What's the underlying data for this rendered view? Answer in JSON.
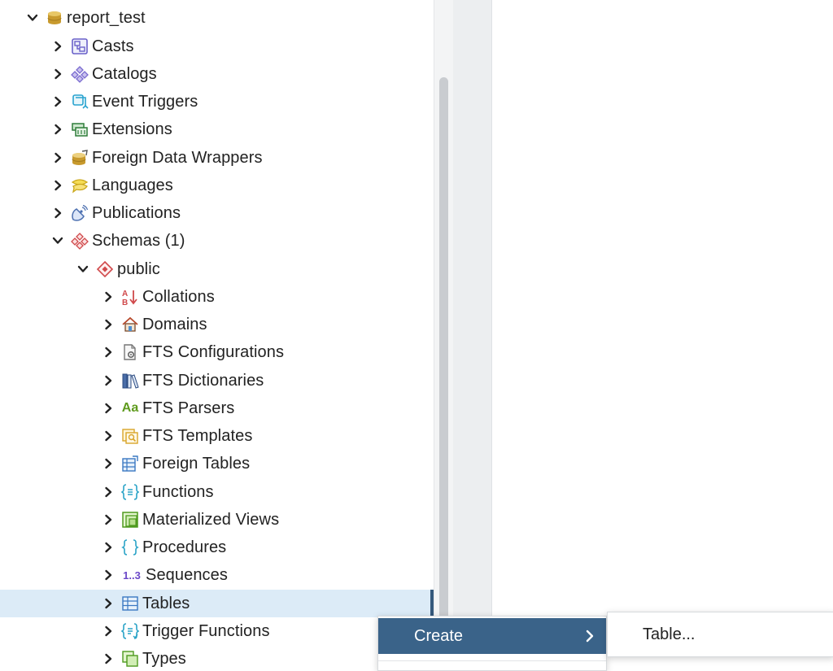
{
  "tree": {
    "database": {
      "label": "report_test",
      "icon": "database-icon",
      "expanded": true
    },
    "database_children": [
      {
        "label": "Casts",
        "icon": "casts-icon"
      },
      {
        "label": "Catalogs",
        "icon": "catalogs-icon"
      },
      {
        "label": "Event Triggers",
        "icon": "event-triggers-icon"
      },
      {
        "label": "Extensions",
        "icon": "extensions-icon"
      },
      {
        "label": "Foreign Data Wrappers",
        "icon": "foreign-data-wrappers-icon"
      },
      {
        "label": "Languages",
        "icon": "languages-icon"
      },
      {
        "label": "Publications",
        "icon": "publications-icon"
      },
      {
        "label": "Schemas (1)",
        "icon": "schemas-icon",
        "expanded": true
      }
    ],
    "schema": {
      "label": "public",
      "icon": "schema-icon",
      "expanded": true
    },
    "schema_children": [
      {
        "label": "Collations",
        "icon": "collations-icon"
      },
      {
        "label": "Domains",
        "icon": "domains-icon"
      },
      {
        "label": "FTS Configurations",
        "icon": "fts-configurations-icon"
      },
      {
        "label": "FTS Dictionaries",
        "icon": "fts-dictionaries-icon"
      },
      {
        "label": "FTS Parsers",
        "icon": "fts-parsers-icon",
        "icon_text": "Aa"
      },
      {
        "label": "FTS Templates",
        "icon": "fts-templates-icon"
      },
      {
        "label": "Foreign Tables",
        "icon": "foreign-tables-icon"
      },
      {
        "label": "Functions",
        "icon": "functions-icon"
      },
      {
        "label": "Materialized Views",
        "icon": "materialized-views-icon"
      },
      {
        "label": "Procedures",
        "icon": "procedures-icon"
      },
      {
        "label": "Sequences",
        "icon": "sequences-icon",
        "icon_text": "1..3"
      },
      {
        "label": "Tables",
        "icon": "tables-icon",
        "selected": true
      },
      {
        "label": "Trigger Functions",
        "icon": "trigger-functions-icon"
      },
      {
        "label": "Types",
        "icon": "types-icon"
      }
    ]
  },
  "context_menu": {
    "items": [
      {
        "label": "Create",
        "highlighted": true,
        "has_submenu": true
      }
    ],
    "submenu": {
      "items": [
        {
          "label": "Table..."
        }
      ]
    }
  },
  "colors": {
    "selection_bg": "#dcebf7",
    "menu_highlight": "#3a6389",
    "selection_marker": "#35597c"
  }
}
